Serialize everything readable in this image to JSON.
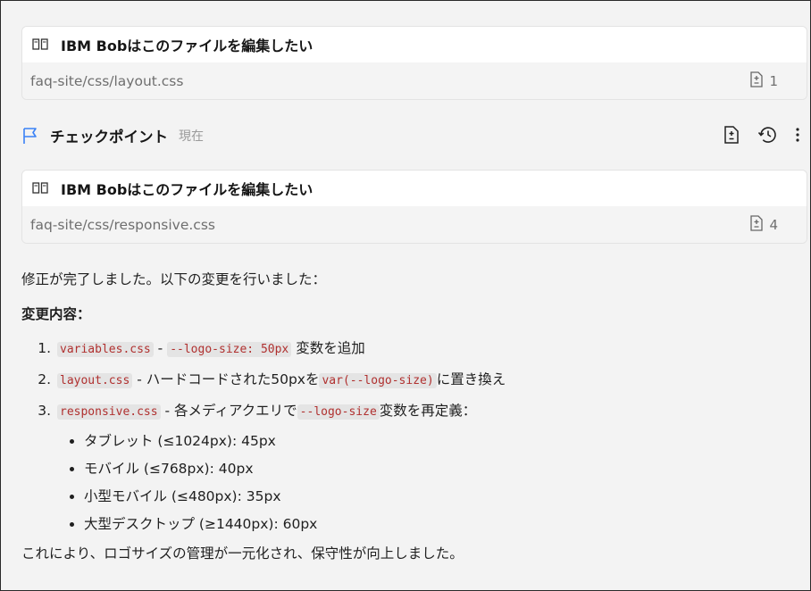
{
  "cards": [
    {
      "title": "IBM Bobはこのファイルを編集したい",
      "file": "faq-site/css/layout.css",
      "diff_count": "1"
    },
    {
      "title": "IBM Bobはこのファイルを編集したい",
      "file": "faq-site/css/responsive.css",
      "diff_count": "4"
    }
  ],
  "checkpoint": {
    "label": "チェックポイント",
    "status": "現在"
  },
  "message": {
    "intro": "修正が完了しました。以下の変更を行いました：",
    "changes_heading": "変更内容：",
    "items": [
      {
        "code1": "variables.css",
        "sep": " - ",
        "code2": "--logo-size: 50px",
        "text": " 変数を追加"
      },
      {
        "code1": "layout.css",
        "sep": " - ハードコードされた50pxを",
        "code2": "var(--logo-size)",
        "text": "に置き換え"
      },
      {
        "code1": "responsive.css",
        "sep": " - 各メディアクエリで",
        "code2": "--logo-size",
        "text": "変数を再定義："
      }
    ],
    "breakpoints": [
      "タブレット (≤1024px): 45px",
      "モバイル (≤768px): 40px",
      "小型モバイル (≤480px): 35px",
      "大型デスクトップ (≥1440px): 60px"
    ],
    "conclusion": "これにより、ロゴサイズの管理が一元化され、保守性が向上しました。"
  },
  "colors": {
    "accent_blue": "#3b82f6",
    "code_red": "#b0302f",
    "muted": "#6f6f6f"
  },
  "icons": {
    "card_header": "book-open-icon",
    "diff": "file-diff-icon",
    "checkpoint": "flag-icon",
    "actions": [
      "file-diff-icon",
      "history-icon",
      "more-vertical-icon"
    ]
  }
}
